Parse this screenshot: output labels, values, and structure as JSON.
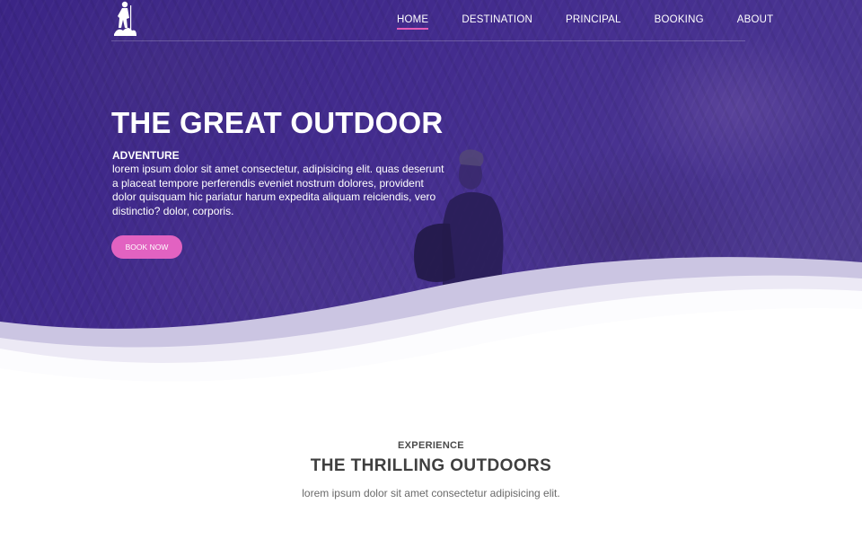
{
  "nav": {
    "logo_alt": "hiker-logo",
    "items": [
      {
        "label": "HOME",
        "active": true
      },
      {
        "label": "DESTINATION",
        "active": false
      },
      {
        "label": "PRINCIPAL",
        "active": false
      },
      {
        "label": "BOOKING",
        "active": false
      },
      {
        "label": "ABOUT",
        "active": false
      }
    ]
  },
  "hero": {
    "title": "THE GREAT OUTDOOR",
    "subtitle": "ADVENTURE",
    "text": "lorem ipsum dolor sit amet consectetur, adipisicing elit. quas deserunt a placeat tempore perferendis eveniet nostrum dolores, provident dolor quisquam hic pariatur harum expedita aliquam reiciendis, vero distinctio? dolor, corporis.",
    "button_label": "BOOK NOW"
  },
  "section": {
    "kicker": "EXPERIENCE",
    "title": "THE THRILLING OUTDOORS",
    "text": "lorem ipsum dolor sit amet consectetur adipisicing elit."
  },
  "colors": {
    "hero_purple": "#3b2586",
    "accent_pink": "#e262c1",
    "wave_light": "#c9c3e0"
  }
}
